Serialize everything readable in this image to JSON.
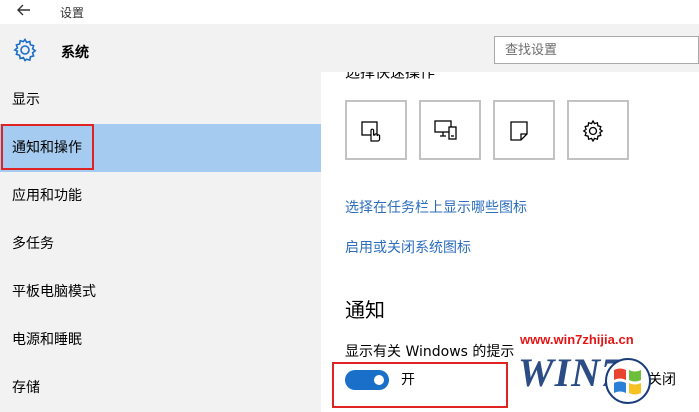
{
  "window": {
    "title": "设置"
  },
  "header": {
    "app_name": "系统",
    "search_placeholder": "查找设置"
  },
  "sidebar": {
    "items": [
      {
        "label": "显示",
        "selected": false
      },
      {
        "label": "通知和操作",
        "selected": true
      },
      {
        "label": "应用和功能",
        "selected": false
      },
      {
        "label": "多任务",
        "selected": false
      },
      {
        "label": "平板电脑模式",
        "selected": false
      },
      {
        "label": "电源和睡眠",
        "selected": false
      },
      {
        "label": "存储",
        "selected": false
      }
    ],
    "selected_bg": "#a6cbf0"
  },
  "content": {
    "quick_actions_heading": "选择快速操作",
    "quick_actions": [
      {
        "icon": "tablet-mode-icon"
      },
      {
        "icon": "connect-icon"
      },
      {
        "icon": "note-icon"
      },
      {
        "icon": "settings-gear-icon"
      }
    ],
    "links": [
      {
        "label": "选择在任务栏上显示哪些图标"
      },
      {
        "label": "启用或关闭系统图标"
      }
    ],
    "notification_section": {
      "title": "通知",
      "setting_label": "显示有关 Windows 的提示",
      "toggle_state": "开",
      "toggle_on": true
    },
    "partial_text": "点击关闭"
  },
  "watermark": {
    "url": "www.win7zhijia.cn",
    "logo": "WIN7"
  },
  "colors": {
    "accent": "#1a6fc9",
    "link": "#2c6ebe",
    "highlight_box": "#e02222",
    "watermark_red": "#e51515"
  }
}
